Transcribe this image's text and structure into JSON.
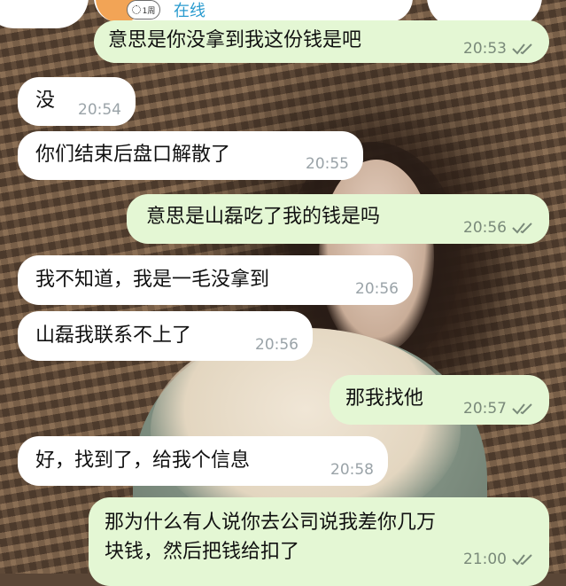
{
  "header": {
    "badge_text": "1周",
    "status": "在线"
  },
  "messages": [
    {
      "dir": "out",
      "text": "意思是你没拿到我这份钱是吧",
      "time": "20:53",
      "read": true
    },
    {
      "dir": "in",
      "text": "没",
      "time": "20:54"
    },
    {
      "dir": "in",
      "text": "你们结束后盘口解散了",
      "time": "20:55"
    },
    {
      "dir": "out",
      "text": "意思是山磊吃了我的钱是吗",
      "time": "20:56",
      "read": true
    },
    {
      "dir": "in",
      "text": "我不知道，我是一毛没拿到",
      "time": "20:56"
    },
    {
      "dir": "in",
      "text": "山磊我联系不上了",
      "time": "20:56"
    },
    {
      "dir": "out",
      "text": "那我找他",
      "time": "20:57",
      "read": true
    },
    {
      "dir": "in",
      "text": "好，找到了，给我个信息",
      "time": "20:58"
    },
    {
      "dir": "out",
      "text_line1": "那为什么有人说你去公司说我差你几万",
      "text_line2": "块钱，然后把钱给扣了",
      "time": "21:00",
      "read": true
    }
  ],
  "colors": {
    "incoming_bubble": "#ffffff",
    "outgoing_bubble": "#e4f7d4",
    "status_accent": "#2a9bcf",
    "timestamp": "#7a8a7a"
  },
  "icons": [
    "double-check-icon",
    "avatar"
  ]
}
